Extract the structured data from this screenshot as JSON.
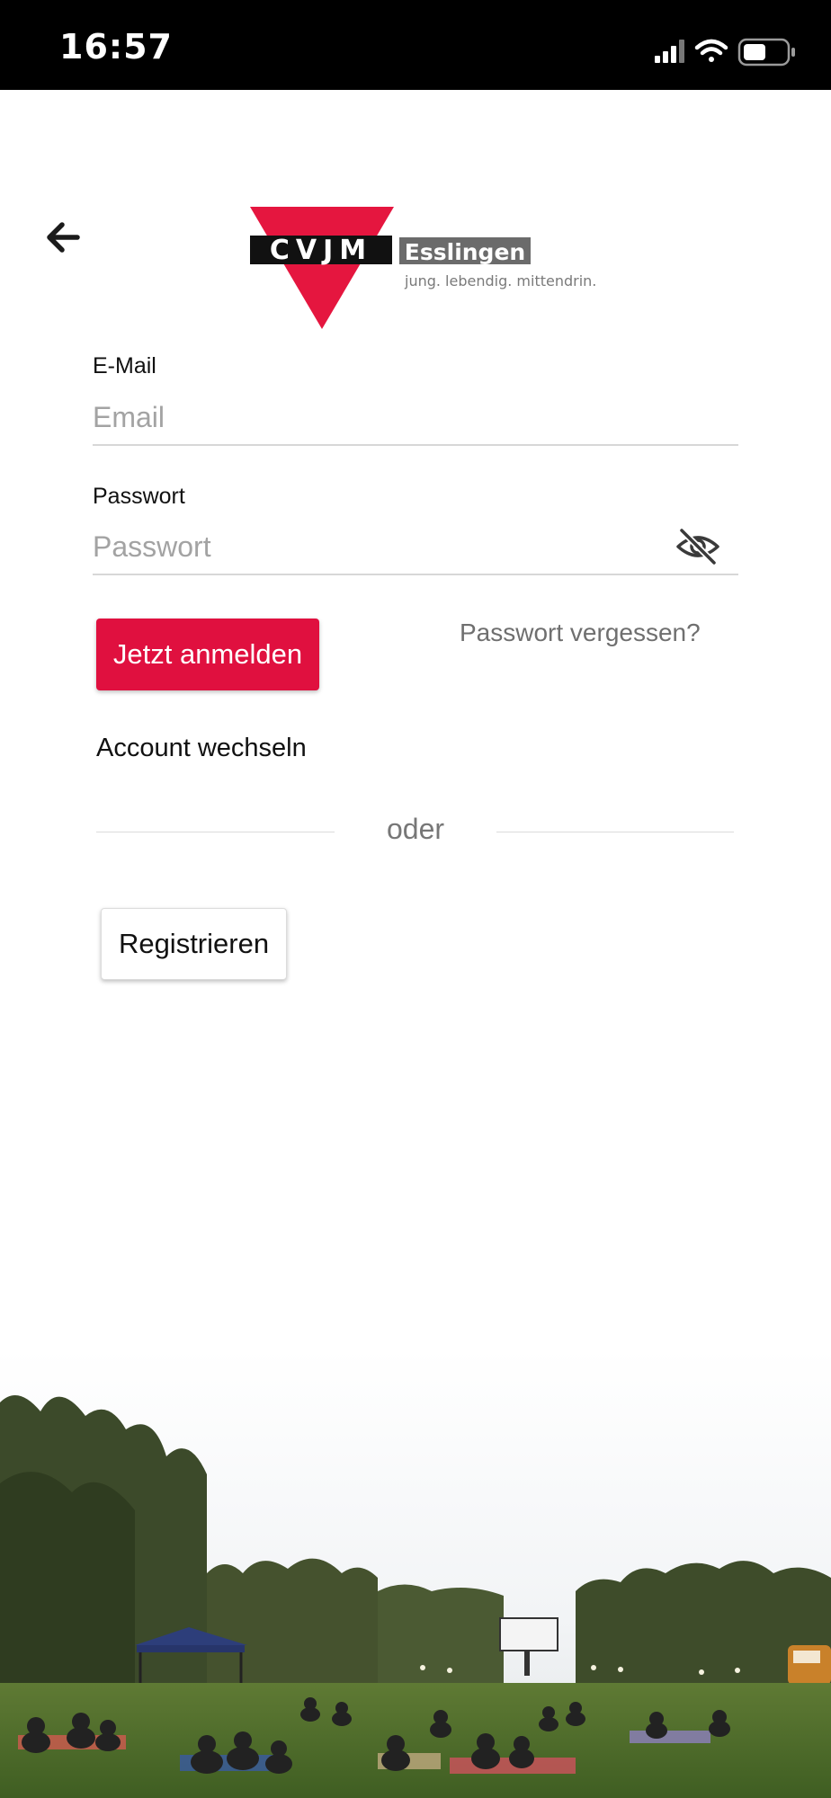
{
  "status_bar": {
    "time": "16:57",
    "icons": [
      "cellular-signal-icon",
      "wifi-icon",
      "battery-icon"
    ]
  },
  "navigation": {
    "back_icon": "arrow-left-icon"
  },
  "logo": {
    "brand": "CVJM",
    "city": "Esslingen",
    "slogan": "jung. lebendig. mittendrin."
  },
  "form": {
    "email_label": "E-Mail",
    "email_placeholder": "Email",
    "email_value": "",
    "password_label": "Passwort",
    "password_placeholder": "Passwort",
    "password_value": "",
    "password_toggle_icon": "eye-slash-icon"
  },
  "actions": {
    "login_label": "Jetzt anmelden",
    "forgot_label": "Passwort vergessen?",
    "switch_account_label": "Account wechseln",
    "divider_label": "oder",
    "register_label": "Registrieren"
  },
  "colors": {
    "accent": "#e0103f",
    "status_bar": "#000000",
    "background": "#ffffff"
  }
}
